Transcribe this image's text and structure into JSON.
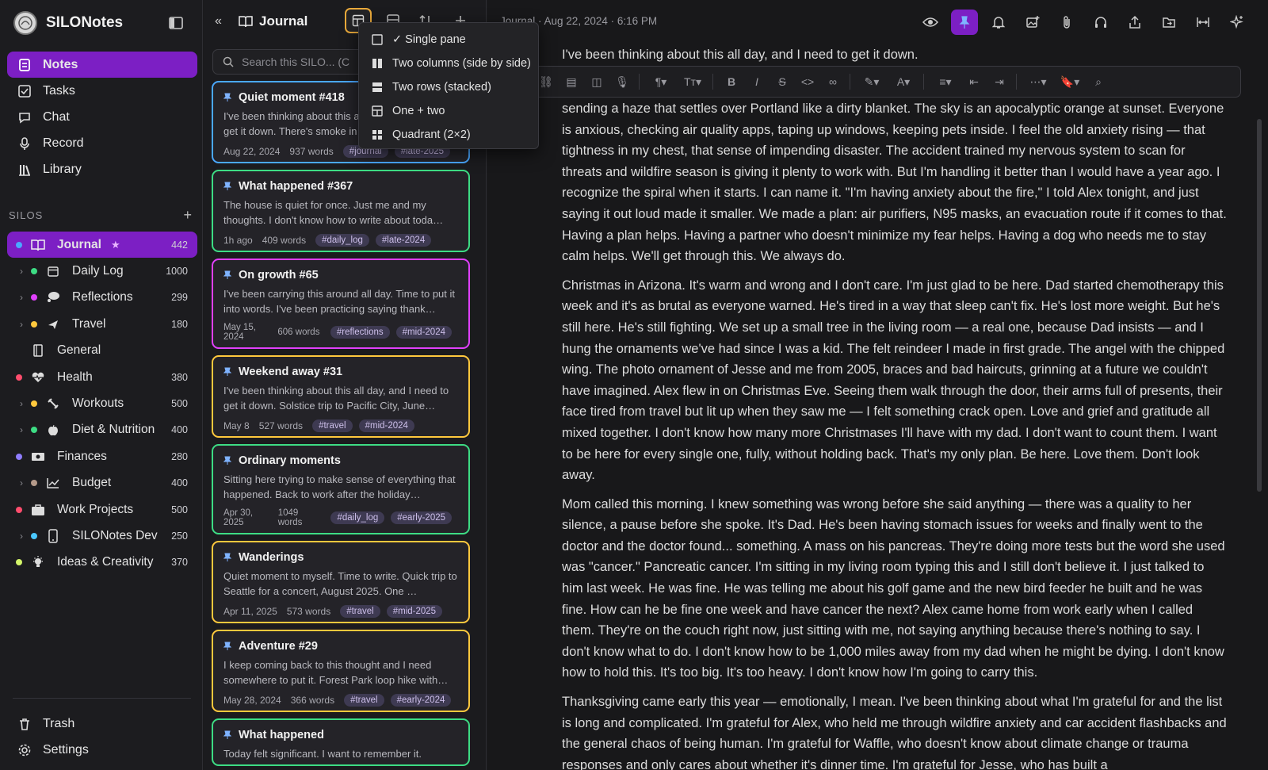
{
  "app": {
    "name": "SILONotes"
  },
  "nav": [
    {
      "id": "notes",
      "label": "Notes",
      "icon": "notes-icon",
      "active": true
    },
    {
      "id": "tasks",
      "label": "Tasks",
      "icon": "tasks-icon"
    },
    {
      "id": "chat",
      "label": "Chat",
      "icon": "chat-icon"
    },
    {
      "id": "record",
      "label": "Record",
      "icon": "mic-icon"
    },
    {
      "id": "library",
      "label": "Library",
      "icon": "library-icon"
    }
  ],
  "silos_header": "SILOS",
  "silos": [
    {
      "label": "Journal",
      "count": "442",
      "color": "#4aa8ff",
      "icon": "book-icon",
      "level": 0,
      "active": true,
      "star": "★"
    },
    {
      "label": "Daily Log",
      "count": "1000",
      "color": "#3ddc84",
      "icon": "calendar-icon",
      "level": 1
    },
    {
      "label": "Reflections",
      "count": "299",
      "color": "#e040fb",
      "icon": "thought-icon",
      "level": 1
    },
    {
      "label": "Travel",
      "count": "180",
      "color": "#ffc83d",
      "icon": "plane-icon",
      "level": 1
    },
    {
      "label": "General",
      "count": "",
      "color": "",
      "icon": "notebook-icon",
      "level": 0
    },
    {
      "label": "Health",
      "count": "380",
      "color": "#ff4d6d",
      "icon": "heartbeat-icon",
      "level": 0
    },
    {
      "label": "Workouts",
      "count": "500",
      "color": "#ffc83d",
      "icon": "dumbbell-icon",
      "level": 1
    },
    {
      "label": "Diet & Nutrition",
      "count": "400",
      "color": "#3ddc84",
      "icon": "apple-icon",
      "level": 1
    },
    {
      "label": "Finances",
      "count": "280",
      "color": "#8f7dff",
      "icon": "money-icon",
      "level": 0
    },
    {
      "label": "Budget",
      "count": "400",
      "color": "#b59a8a",
      "icon": "chart-line-icon",
      "level": 1
    },
    {
      "label": "Work Projects",
      "count": "500",
      "color": "#ff4d6d",
      "icon": "briefcase-icon",
      "level": 0
    },
    {
      "label": "SILONotes Dev",
      "count": "250",
      "color": "#4ac8ff",
      "icon": "phone-icon",
      "level": 1
    },
    {
      "label": "Ideas & Creativity",
      "count": "370",
      "color": "#d4f56a",
      "icon": "bulb-icon",
      "level": 0
    }
  ],
  "bottom_nav": [
    {
      "label": "Trash",
      "icon": "trash-icon"
    },
    {
      "label": "Settings",
      "icon": "gear-icon"
    }
  ],
  "list": {
    "title": "Journal",
    "search_placeholder": "Search this SILO... (C"
  },
  "layout_menu": [
    {
      "label": "Single pane",
      "checked": true,
      "icon": "single-pane-icon",
      "check": "✓"
    },
    {
      "label": "Two columns (side by side)",
      "icon": "two-columns-icon"
    },
    {
      "label": "Two rows (stacked)",
      "icon": "two-rows-icon"
    },
    {
      "label": "One + two",
      "icon": "one-plus-two-icon"
    },
    {
      "label": "Quadrant (2×2)",
      "icon": "quadrant-icon"
    }
  ],
  "cards": [
    {
      "title": "Quiet moment #418",
      "preview": "I've been thinking about this all day, and I need to get it down. There's smoke in",
      "date": "Aug 22, 2024",
      "words": "937 words",
      "tags": [
        "#journal",
        "#late-2025"
      ],
      "color": "#4aa8ff",
      "selected": true
    },
    {
      "title": "What happened #367",
      "preview": "The house is quiet for once. Just me and my thoughts. I don't know how to write about toda…",
      "date": "1h ago",
      "words": "409 words",
      "tags": [
        "#daily_log",
        "#late-2024"
      ],
      "color": "#3ddc84"
    },
    {
      "title": "On growth #65",
      "preview": "I've been carrying this around all day. Time to put it into words. I've been practicing saying thank…",
      "date": "May 15, 2024",
      "words": "606 words",
      "tags": [
        "#reflections",
        "#mid-2024"
      ],
      "color": "#e040fb",
      "twoline": true
    },
    {
      "title": "Weekend away #31",
      "preview": "I've been thinking about this all day, and I need to get it down. Solstice trip to Pacific City, June…",
      "date": "May 8",
      "words": "527 words",
      "tags": [
        "#travel",
        "#mid-2024"
      ],
      "color": "#ffc83d"
    },
    {
      "title": "Ordinary moments",
      "preview": "Sitting here trying to make sense of everything that happened. Back to work after the holiday…",
      "date": "Apr 30, 2025",
      "words": "1049 words",
      "tags": [
        "#daily_log",
        "#early-2025"
      ],
      "color": "#3ddc84",
      "twoline": true
    },
    {
      "title": "Wanderings",
      "preview": "Quiet moment to myself. Time to write. Quick trip to Seattle for a concert, August 2025. One …",
      "date": "Apr 11, 2025",
      "words": "573 words",
      "tags": [
        "#travel",
        "#mid-2025"
      ],
      "color": "#ffc83d"
    },
    {
      "title": "Adventure #29",
      "preview": "I keep coming back to this thought and I need somewhere to put it. Forest Park loop hike with…",
      "date": "May 28, 2024",
      "words": "366 words",
      "tags": [
        "#travel",
        "#early-2024"
      ],
      "color": "#ffc83d"
    },
    {
      "title": "What happened",
      "preview": "Today felt significant. I want to remember it.",
      "date": "",
      "words": "",
      "tags": [],
      "color": "#3ddc84"
    }
  ],
  "editor": {
    "breadcrumb": "Journal · Aug 22, 2024 · 6:16 PM",
    "first_line": "I've been thinking about this all day, and I need to get it down.",
    "paragraphs": [
      "sending a haze that settles over Portland like a dirty blanket. The sky is an apocalyptic orange at sunset. Everyone is anxious, checking air quality apps, taping up windows, keeping pets inside. I feel the old anxiety rising — that tightness in my chest, that sense of impending disaster. The accident trained my nervous system to scan for threats and wildfire season is giving it plenty to work with. But I'm handling it better than I would have a year ago. I recognize the spiral when it starts. I can name it. \"I'm having anxiety about the fire,\" I told Alex tonight, and just saying it out loud made it smaller. We made a plan: air purifiers, N95 masks, an evacuation route if it comes to that. Having a plan helps. Having a partner who doesn't minimize my fear helps. Having a dog who needs me to stay calm helps. We'll get through this. We always do.",
      "Christmas in Arizona. It's warm and wrong and I don't care. I'm just glad to be here. Dad started chemotherapy this week and it's as brutal as everyone warned. He's tired in a way that sleep can't fix. He's lost more weight. But he's still here. He's still fighting. We set up a small tree in the living room — a real one, because Dad insists — and I hung the ornaments we've had since I was a kid. The felt reindeer I made in first grade. The angel with the chipped wing. The photo ornament of Jesse and me from 2005, braces and bad haircuts, grinning at a future we couldn't have imagined. Alex flew in on Christmas Eve. Seeing them walk through the door, their arms full of presents, their face tired from travel but lit up when they saw me — I felt something crack open. Love and grief and gratitude all mixed together. I don't know how many more Christmases I'll have with my dad. I don't want to count them. I want to be here for every single one, fully, without holding back. That's my only plan. Be here. Love them. Don't look away.",
      "Mom called this morning. I knew something was wrong before she said anything — there was a quality to her silence, a pause before she spoke. It's Dad. He's been having stomach issues for weeks and finally went to the doctor and the doctor found... something. A mass on his pancreas. They're doing more tests but the word she used was \"cancer.\" Pancreatic cancer. I'm sitting in my living room typing this and I still don't believe it. I just talked to him last week. He was fine. He was telling me about his golf game and the new bird feeder he built and he was fine. How can he be fine one week and have cancer the next? Alex came home from work early when I called them. They're on the couch right now, just sitting with me, not saying anything because there's nothing to say. I don't know what to do. I don't know how to be 1,000 miles away from my dad when he might be dying. I don't know how to hold this. It's too big. It's too heavy. I don't know how I'm going to carry this.",
      "Thanksgiving came early this year — emotionally, I mean. I've been thinking about what I'm grateful for and the list is long and complicated. I'm grateful for Alex, who held me through wildfire anxiety and car accident flashbacks and the general chaos of being human. I'm grateful for Waffle, who doesn't know about climate change or trauma responses and only cares about whether it's dinner time. I'm grateful for Jesse, who has built a"
    ]
  }
}
